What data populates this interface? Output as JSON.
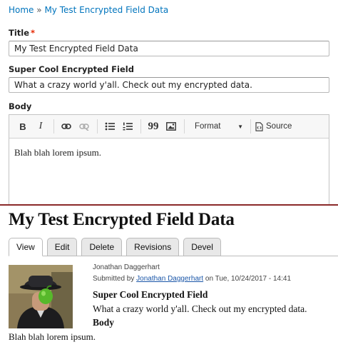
{
  "edit_form": {
    "breadcrumb": {
      "home": "Home",
      "separator": "»",
      "current": "My Test Encrypted Field Data"
    },
    "title_label": "Title",
    "required_mark": "*",
    "title_value": "My Test Encrypted Field Data",
    "encrypted_label": "Super Cool Encrypted Field",
    "encrypted_value": "What a crazy world y'all. Check out my encrypted data.",
    "body_label": "Body",
    "toolbar": {
      "bold": "B",
      "italic": "I",
      "blockquote": "99",
      "format": "Format",
      "source": "Source"
    },
    "body_value": "Blah blah lorem ipsum."
  },
  "node_view": {
    "title": "My Test Encrypted Field Data",
    "tabs": [
      {
        "label": "View",
        "active": true
      },
      {
        "label": "Edit"
      },
      {
        "label": "Delete"
      },
      {
        "label": "Revisions"
      },
      {
        "label": "Devel"
      }
    ],
    "author_name": "Jonathan Daggerhart",
    "submitted_prefix": "Submitted by",
    "submitted_author": "Jonathan Daggerhart",
    "submitted_suffix": "on Tue, 10/24/2017 - 14:41",
    "encrypted_label": "Super Cool Encrypted Field",
    "encrypted_value": "What a crazy world y'all. Check out my encrypted data.",
    "body_label": "Body",
    "body_value": "Blah blah lorem ipsum."
  },
  "colors": {
    "link": "#0074bd",
    "required": "#e62600",
    "divider": "#8a2a2a"
  }
}
